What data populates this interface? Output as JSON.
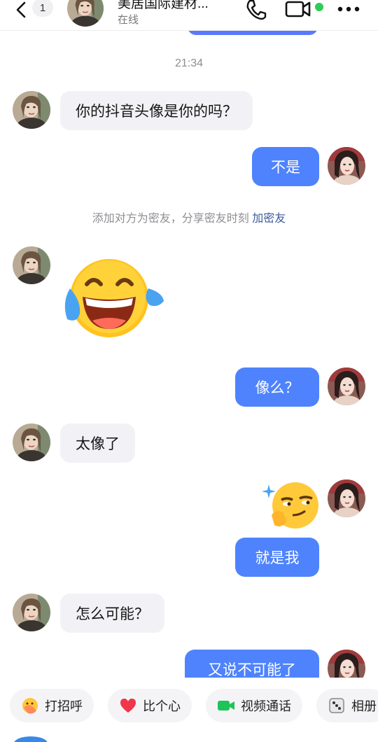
{
  "header": {
    "unread_count": "1",
    "title": "美居国际建材...",
    "status": "在线",
    "icons": [
      "back-chevron-icon",
      "phone-icon",
      "video-camera-icon",
      "more-dots-icon"
    ],
    "online_color": "#2ecc55"
  },
  "chat": {
    "time": "21:34",
    "messages": [
      {
        "side": "in",
        "type": "text",
        "text": "你的抖音头像是你的吗？"
      },
      {
        "side": "out",
        "type": "text",
        "text": "不是"
      },
      {
        "side": "in",
        "type": "emoji",
        "emoji": "laughing-tears-emoji"
      },
      {
        "side": "out",
        "type": "text",
        "text": "像么？"
      },
      {
        "side": "in",
        "type": "text",
        "text": "太像了"
      },
      {
        "side": "out",
        "type": "emoji",
        "emoji": "smug-thinking-emoji"
      },
      {
        "side": "out",
        "type": "text",
        "text": "就是我"
      },
      {
        "side": "in",
        "type": "text",
        "text": "怎么可能？"
      },
      {
        "side": "out",
        "type": "text",
        "text": "又说不可能了"
      }
    ],
    "system_text": "添加对方为密友，分享密友时刻",
    "system_link": "加密友",
    "outgoing_color": "#4e83fd",
    "incoming_color": "#f2f2f6"
  },
  "quick_actions": [
    {
      "label": "打招呼",
      "icon": "wave-emoji-icon"
    },
    {
      "label": "比个心",
      "icon": "heart-icon"
    },
    {
      "label": "视频通话",
      "icon": "video-call-icon"
    },
    {
      "label": "相册",
      "icon": "dice-icon"
    }
  ]
}
